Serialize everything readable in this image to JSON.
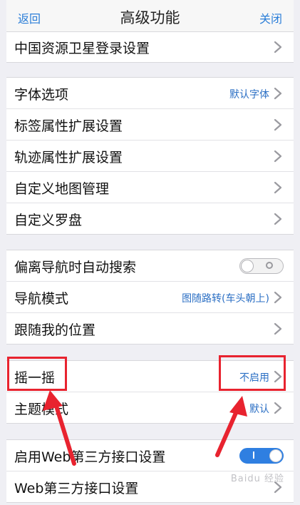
{
  "nav": {
    "back": "返回",
    "title": "高级功能",
    "close": "关闭"
  },
  "group0": {
    "items": [
      {
        "label": "中国资源卫星登录设置",
        "value": ""
      }
    ]
  },
  "group1": {
    "items": [
      {
        "label": "字体选项",
        "value": "默认字体"
      },
      {
        "label": "标签属性扩展设置",
        "value": ""
      },
      {
        "label": "轨迹属性扩展设置",
        "value": ""
      },
      {
        "label": "自定义地图管理",
        "value": ""
      },
      {
        "label": "自定义罗盘",
        "value": ""
      }
    ]
  },
  "group2": {
    "items": [
      {
        "label": "偏离导航时自动搜索",
        "toggle": "off"
      },
      {
        "label": "导航模式",
        "value": "图随路转(车头朝上)"
      },
      {
        "label": "跟随我的位置",
        "value": ""
      }
    ]
  },
  "group3": {
    "items": [
      {
        "label": "摇一摇",
        "value": "不启用"
      },
      {
        "label": "主题模式",
        "value": "默认"
      }
    ]
  },
  "group4": {
    "items": [
      {
        "label": "启用Web第三方接口设置",
        "toggle": "on"
      },
      {
        "label": "Web第三方接口设置",
        "value": ""
      }
    ]
  },
  "watermark": "Baidu 经验",
  "colors": {
    "accent": "#2b7ed8",
    "highlight": "#e8232f",
    "toggle_on": "#2f7fe1"
  }
}
